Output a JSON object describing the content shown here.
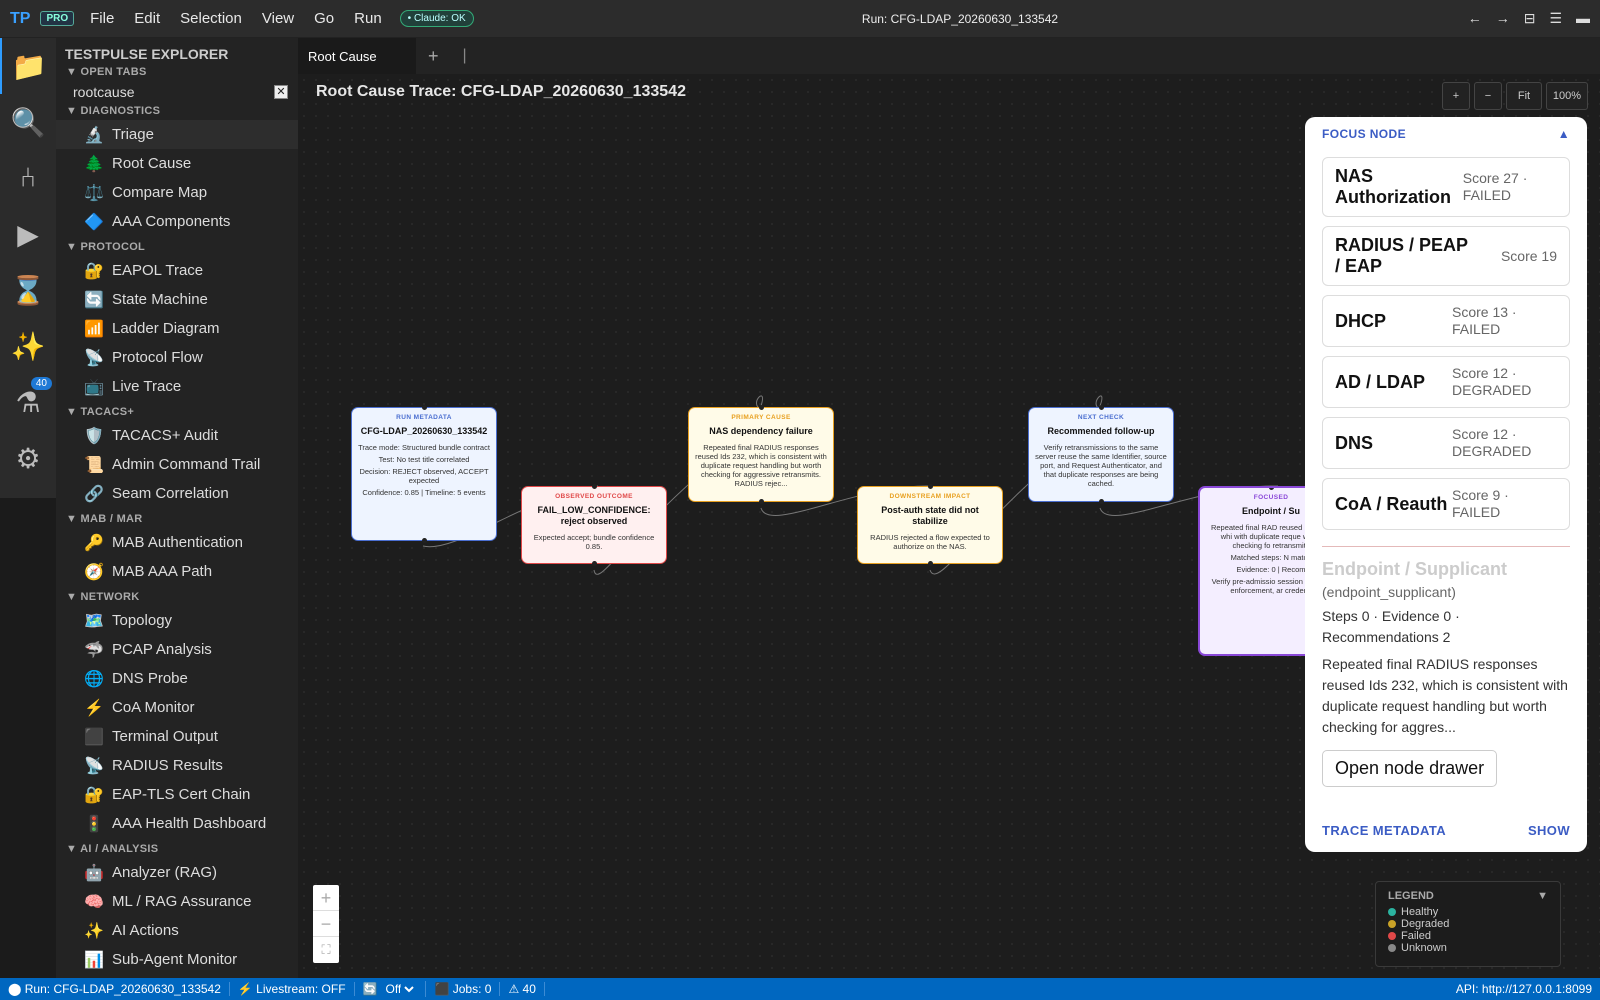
{
  "app": {
    "logo": "TP",
    "badge": "PRO",
    "claude_status": "• Claude: OK",
    "run_title": "Run: CFG-LDAP_20260630_133542",
    "menu": [
      "File",
      "Edit",
      "Selection",
      "View",
      "Go",
      "Run"
    ]
  },
  "activity": {
    "badge": "40",
    "icons": [
      "files-icon",
      "search-icon",
      "git-icon",
      "run-icon",
      "hourglass-icon",
      "sparkles-icon",
      "flask-icon",
      "gear-icon"
    ]
  },
  "sidebar": {
    "title": "TESTPULSE EXPLORER",
    "open_tabs_header": "▼  OPEN TABS",
    "open_tab": "rootcause",
    "close": "✕",
    "sections": [
      {
        "label": "▼  DIAGNOSTICS",
        "items": [
          {
            "icon": "🔬",
            "label": "Triage"
          },
          {
            "icon": "🌲",
            "label": "Root Cause"
          },
          {
            "icon": "⚖️",
            "label": "Compare Map"
          },
          {
            "icon": "🔷",
            "label": "AAA Components"
          }
        ]
      },
      {
        "label": "▼  PROTOCOL",
        "items": [
          {
            "icon": "🔐",
            "label": "EAPOL Trace"
          },
          {
            "icon": "🔄",
            "label": "State Machine"
          },
          {
            "icon": "📶",
            "label": "Ladder Diagram"
          },
          {
            "icon": "📡",
            "label": "Protocol Flow"
          },
          {
            "icon": "📺",
            "label": "Live Trace"
          }
        ]
      },
      {
        "label": "▼  TACACS+",
        "items": [
          {
            "icon": "🛡️",
            "label": "TACACS+ Audit"
          },
          {
            "icon": "📜",
            "label": "Admin Command Trail"
          },
          {
            "icon": "🔗",
            "label": "Seam Correlation"
          }
        ]
      },
      {
        "label": "▼  MAB / MAR",
        "items": [
          {
            "icon": "🔑",
            "label": "MAB Authentication"
          },
          {
            "icon": "🧭",
            "label": "MAB AAA Path"
          }
        ]
      },
      {
        "label": "▼  NETWORK",
        "items": [
          {
            "icon": "🗺️",
            "label": "Topology"
          },
          {
            "icon": "🦈",
            "label": "PCAP Analysis"
          },
          {
            "icon": "🌐",
            "label": "DNS Probe"
          },
          {
            "icon": "⚡",
            "label": "CoA Monitor"
          },
          {
            "icon": "⬛",
            "label": "Terminal Output"
          },
          {
            "icon": "📡",
            "label": "RADIUS Results"
          },
          {
            "icon": "🔐",
            "label": "EAP-TLS Cert Chain"
          },
          {
            "icon": "🚦",
            "label": "AAA Health Dashboard"
          }
        ]
      },
      {
        "label": "▼  AI / ANALYSIS",
        "items": [
          {
            "icon": "🤖",
            "label": "Analyzer (RAG)"
          },
          {
            "icon": "🧠",
            "label": "ML / RAG Assurance"
          },
          {
            "icon": "✨",
            "label": "AI Actions"
          },
          {
            "icon": "📊",
            "label": "Sub-Agent Monitor"
          }
        ]
      }
    ]
  },
  "tabs": {
    "active": "Root Cause",
    "add": "+",
    "sep": "|"
  },
  "canvas": {
    "title": "Root Cause Trace: CFG-LDAP_20260630_133542",
    "zoom": [
      "+",
      "−",
      "Fit",
      "100%"
    ],
    "mini_zoom": [
      "+",
      "−",
      "⛶"
    ]
  },
  "nodes": [
    {
      "kind": "RUN METADATA",
      "title": "CFG-LDAP_20260630_133542",
      "lines": [
        "Trace mode: Structured bundle contract",
        "Test: No test title correlated",
        "Decision: REJECT observed, ACCEPT expected",
        "Confidence: 0.85 | Timeline: 5 events"
      ],
      "status": "unknown"
    },
    {
      "kind": "OBSERVED OUTCOME",
      "title": "FAIL_LOW_CONFIDENCE: reject observed",
      "lines": [
        "Expected accept; bundle confidence 0.85."
      ],
      "status": "failed"
    },
    {
      "kind": "PRIMARY CAUSE",
      "title": "NAS dependency failure",
      "lines": [
        "Repeated final RADIUS responses reused Ids 232, which is consistent with duplicate request handling but worth checking for aggressive retransmits. RADIUS rejec..."
      ],
      "status": "degraded"
    },
    {
      "kind": "DOWNSTREAM IMPACT",
      "title": "Post-auth state did not stabilize",
      "lines": [
        "RADIUS rejected a flow expected to authorize on the NAS."
      ],
      "status": "degraded"
    },
    {
      "kind": "NEXT CHECK",
      "title": "Recommended follow-up",
      "lines": [
        "Verify retransmissions to the same server reuse the same Identifier, source port, and Request Authenticator, and that duplicate responses are being cached."
      ],
      "status": "unknown"
    },
    {
      "kind": "FOCUSED",
      "title": "Endpoint / Su",
      "lines": [
        "Repeated final RAD reused Ids 232, whi with duplicate reque worth checking fo retransmits",
        "Matched steps: N match",
        "Evidence: 0 | Recom",
        "Verify pre-admissio session state, V enforcement, ar credenti"
      ],
      "status": "focused"
    }
  ],
  "focus": {
    "header": "FOCUS NODE",
    "collapse": "▲",
    "cards": [
      {
        "name": "NAS Authorization",
        "score": "Score 27 · FAILED"
      },
      {
        "name": "RADIUS / PEAP / EAP",
        "score": "Score 19"
      },
      {
        "name": "DHCP",
        "score": "Score 13 · FAILED"
      },
      {
        "name": "AD / LDAP",
        "score": "Score 12 · DEGRADED"
      },
      {
        "name": "DNS",
        "score": "Score 12 · DEGRADED"
      },
      {
        "name": "CoA / Reauth",
        "score": "Score 9 · FAILED"
      }
    ],
    "title": "Endpoint / Supplicant",
    "subtitle": "(endpoint_supplicant)",
    "stats": "Steps 0 · Evidence 0 · Recommendations 2",
    "description": "Repeated final RADIUS responses reused Ids 232, which is consistent with duplicate request handling but worth checking for aggres...",
    "button": "Open node drawer",
    "footer_left": "TRACE METADATA",
    "footer_right": "SHOW"
  },
  "legend": {
    "title": "LEGEND",
    "toggle": "▼",
    "items": [
      {
        "label": "Healthy",
        "color": "#2bb3a0"
      },
      {
        "label": "Degraded",
        "color": "#c9a227"
      },
      {
        "label": "Failed",
        "color": "#e04848"
      },
      {
        "label": "Unknown",
        "color": "#888888"
      }
    ]
  },
  "status": {
    "run": "⬤ Run: CFG-LDAP_20260630_133542",
    "livestream": "⚡ Livestream: OFF",
    "refresh_icon": "🔄",
    "refresh": "Off",
    "jobs": "⬛ Jobs: 0",
    "warnings": "⚠ 40",
    "api": "API: http://127.0.0.1:8099"
  },
  "colors": {
    "accent": "#0067c0",
    "failed": "#e04848",
    "degraded": "#e8a020",
    "unknown": "#4a6ed0",
    "focused": "#8a48d8"
  }
}
